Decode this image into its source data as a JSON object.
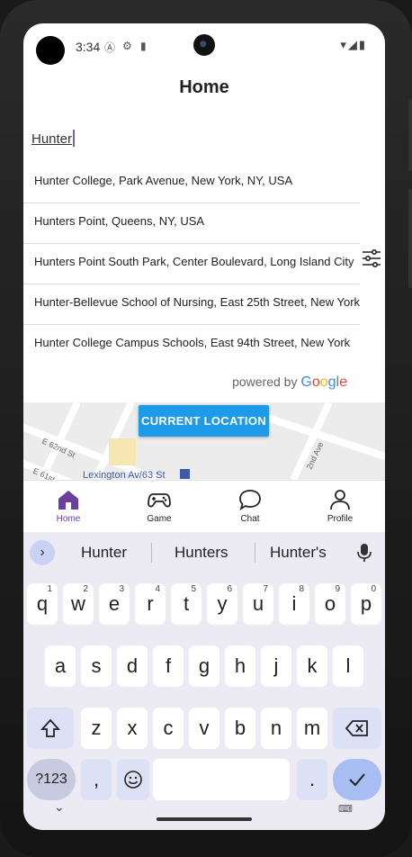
{
  "status": {
    "time": "3:34"
  },
  "header": {
    "title": "Home"
  },
  "search": {
    "value": "Hunter",
    "suggestions": [
      "Hunter College, Park Avenue, New York, NY, USA",
      "Hunters Point, Queens, NY, USA",
      "Hunters Point South Park, Center Boulevard, Long Island City",
      "Hunter-Bellevue School of Nursing, East 25th Street, New York",
      "Hunter College Campus Schools, East 94th Street, New York"
    ],
    "powered_by": "powered by",
    "google": "Google"
  },
  "map": {
    "current_location": "CURRENT LOCATION",
    "labels": [
      "E 62nd St",
      "E 61st",
      "Lexington Av/63 St",
      "2nd Ave"
    ]
  },
  "tabs": [
    {
      "label": "Home",
      "icon": "home-icon",
      "active": true
    },
    {
      "label": "Game",
      "icon": "gamepad-icon",
      "active": false
    },
    {
      "label": "Chat",
      "icon": "chat-icon",
      "active": false
    },
    {
      "label": "Profile",
      "icon": "person-icon",
      "active": false
    }
  ],
  "keyboard": {
    "suggestions": [
      "Hunter",
      "Hunters",
      "Hunter's"
    ],
    "row1": [
      [
        "q",
        "1"
      ],
      [
        "w",
        "2"
      ],
      [
        "e",
        "3"
      ],
      [
        "r",
        "4"
      ],
      [
        "t",
        "5"
      ],
      [
        "y",
        "6"
      ],
      [
        "u",
        "7"
      ],
      [
        "i",
        "8"
      ],
      [
        "o",
        "9"
      ],
      [
        "p",
        "0"
      ]
    ],
    "row2": [
      "a",
      "s",
      "d",
      "f",
      "g",
      "h",
      "j",
      "k",
      "l"
    ],
    "row3": [
      "z",
      "x",
      "c",
      "v",
      "b",
      "n",
      "m"
    ],
    "symbols": "?123",
    "comma": ",",
    "period": "."
  },
  "colors": {
    "accent": "#6a3fa0",
    "button": "#1e9be8",
    "keyboard_bg": "#ecebf4"
  }
}
